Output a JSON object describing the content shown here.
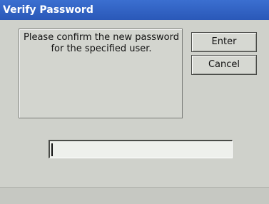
{
  "window": {
    "title": "Verify Password"
  },
  "message": {
    "text": "Please confirm the new password for the specified user."
  },
  "buttons": {
    "enter_label": "Enter",
    "cancel_label": "Cancel"
  },
  "password_input": {
    "value": ""
  },
  "colors": {
    "title_bar": "#2f62c4",
    "dialog_background": "#cfd1cb"
  }
}
